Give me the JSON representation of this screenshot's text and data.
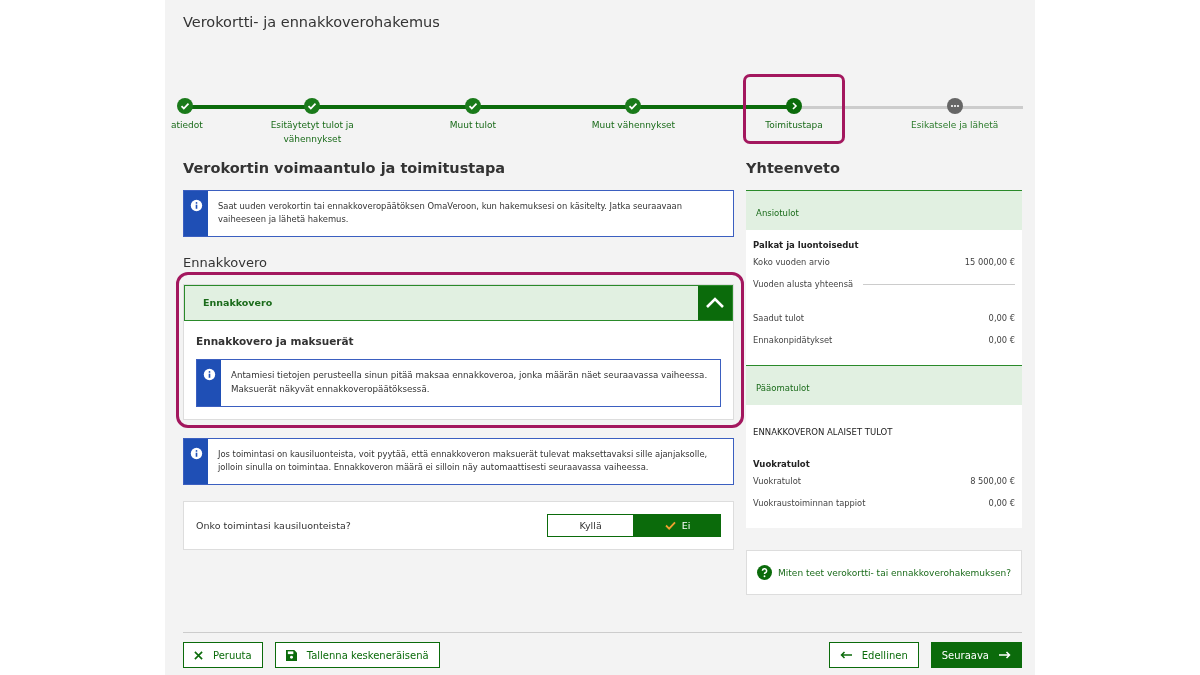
{
  "page_title": "Verokortti- ja ennakkoverohakemus",
  "steps": [
    {
      "label": "atiedot",
      "kind": "done",
      "highlighted": false
    },
    {
      "label": "Esitäytetyt tulot ja vähennykset",
      "kind": "done",
      "highlighted": false
    },
    {
      "label": "Muut tulot",
      "kind": "done",
      "highlighted": false
    },
    {
      "label": "Muut vähennykset",
      "kind": "done",
      "highlighted": false
    },
    {
      "label": "Toimitustapa",
      "kind": "current",
      "highlighted": true
    },
    {
      "label": "Esikatsele ja lähetä",
      "kind": "upcoming",
      "highlighted": false
    }
  ],
  "section_title": "Verokortin voimaantulo ja toimitustapa",
  "info_text": "Saat uuden verokortin tai ennakkoveropäätöksen OmaVeroon, kun hakemuksesi on käsitelty. Jatka seuraavaan vaiheeseen ja lähetä hakemus.",
  "subsection_title": "Ennakkovero",
  "accordion": {
    "title": "Ennakkovero",
    "expanded": true,
    "highlighted": true,
    "heading": "Ennakkovero ja maksuerät",
    "info_text": "Antamiesi tietojen perusteella sinun pitää maksaa ennakkoveroa, jonka määrän näet seuraavassa vaiheessa. Maksuerät näkyvät ennakkoveropäätöksessä."
  },
  "seasonal_info": "Jos toimintasi on kausiluonteista, voit pyytää, että ennakkoveron maksuerät tulevat maksettavaksi sille ajanjaksolle, jolloin sinulla on toimintaa. Ennakkoveron määrä ei silloin näy automaattisesti seuraavassa vaiheessa.",
  "question": {
    "label": "Onko toimintasi kausiluonteista?",
    "options": [
      {
        "label": "Kyllä",
        "selected": false
      },
      {
        "label": "Ei",
        "selected": true
      }
    ]
  },
  "summary": {
    "title": "Yhteenveto",
    "groups": [
      {
        "title": "Ansiotulot",
        "items": [
          {
            "kind": "heading",
            "label": "Palkat ja luontoisedut"
          },
          {
            "kind": "row",
            "label": "Koko vuoden arvio",
            "value": "15 000,00 €"
          },
          {
            "kind": "divider",
            "label": "Vuoden alusta yhteensä"
          },
          {
            "kind": "row",
            "label": "Saadut tulot",
            "value": "0,00 €"
          },
          {
            "kind": "row",
            "label": "Ennakonpidätykset",
            "value": "0,00 €"
          }
        ]
      },
      {
        "title": "Pääomatulot",
        "items": [
          {
            "kind": "caps",
            "label": "ENNAKKOVERON ALAISET TULOT"
          },
          {
            "kind": "heading",
            "label": "Vuokratulot"
          },
          {
            "kind": "row",
            "label": "Vuokratulot",
            "value": "8 500,00 €"
          },
          {
            "kind": "row",
            "label": "Vuokraustoiminnan tappiot",
            "value": "0,00 €"
          }
        ]
      }
    ],
    "help_link": "Miten teet verokortti- tai ennakkoverohakemuksen?"
  },
  "footer": {
    "cancel": "Peruuta",
    "save": "Tallenna keskeneräisenä",
    "previous": "Edellinen",
    "next": "Seuraava"
  }
}
